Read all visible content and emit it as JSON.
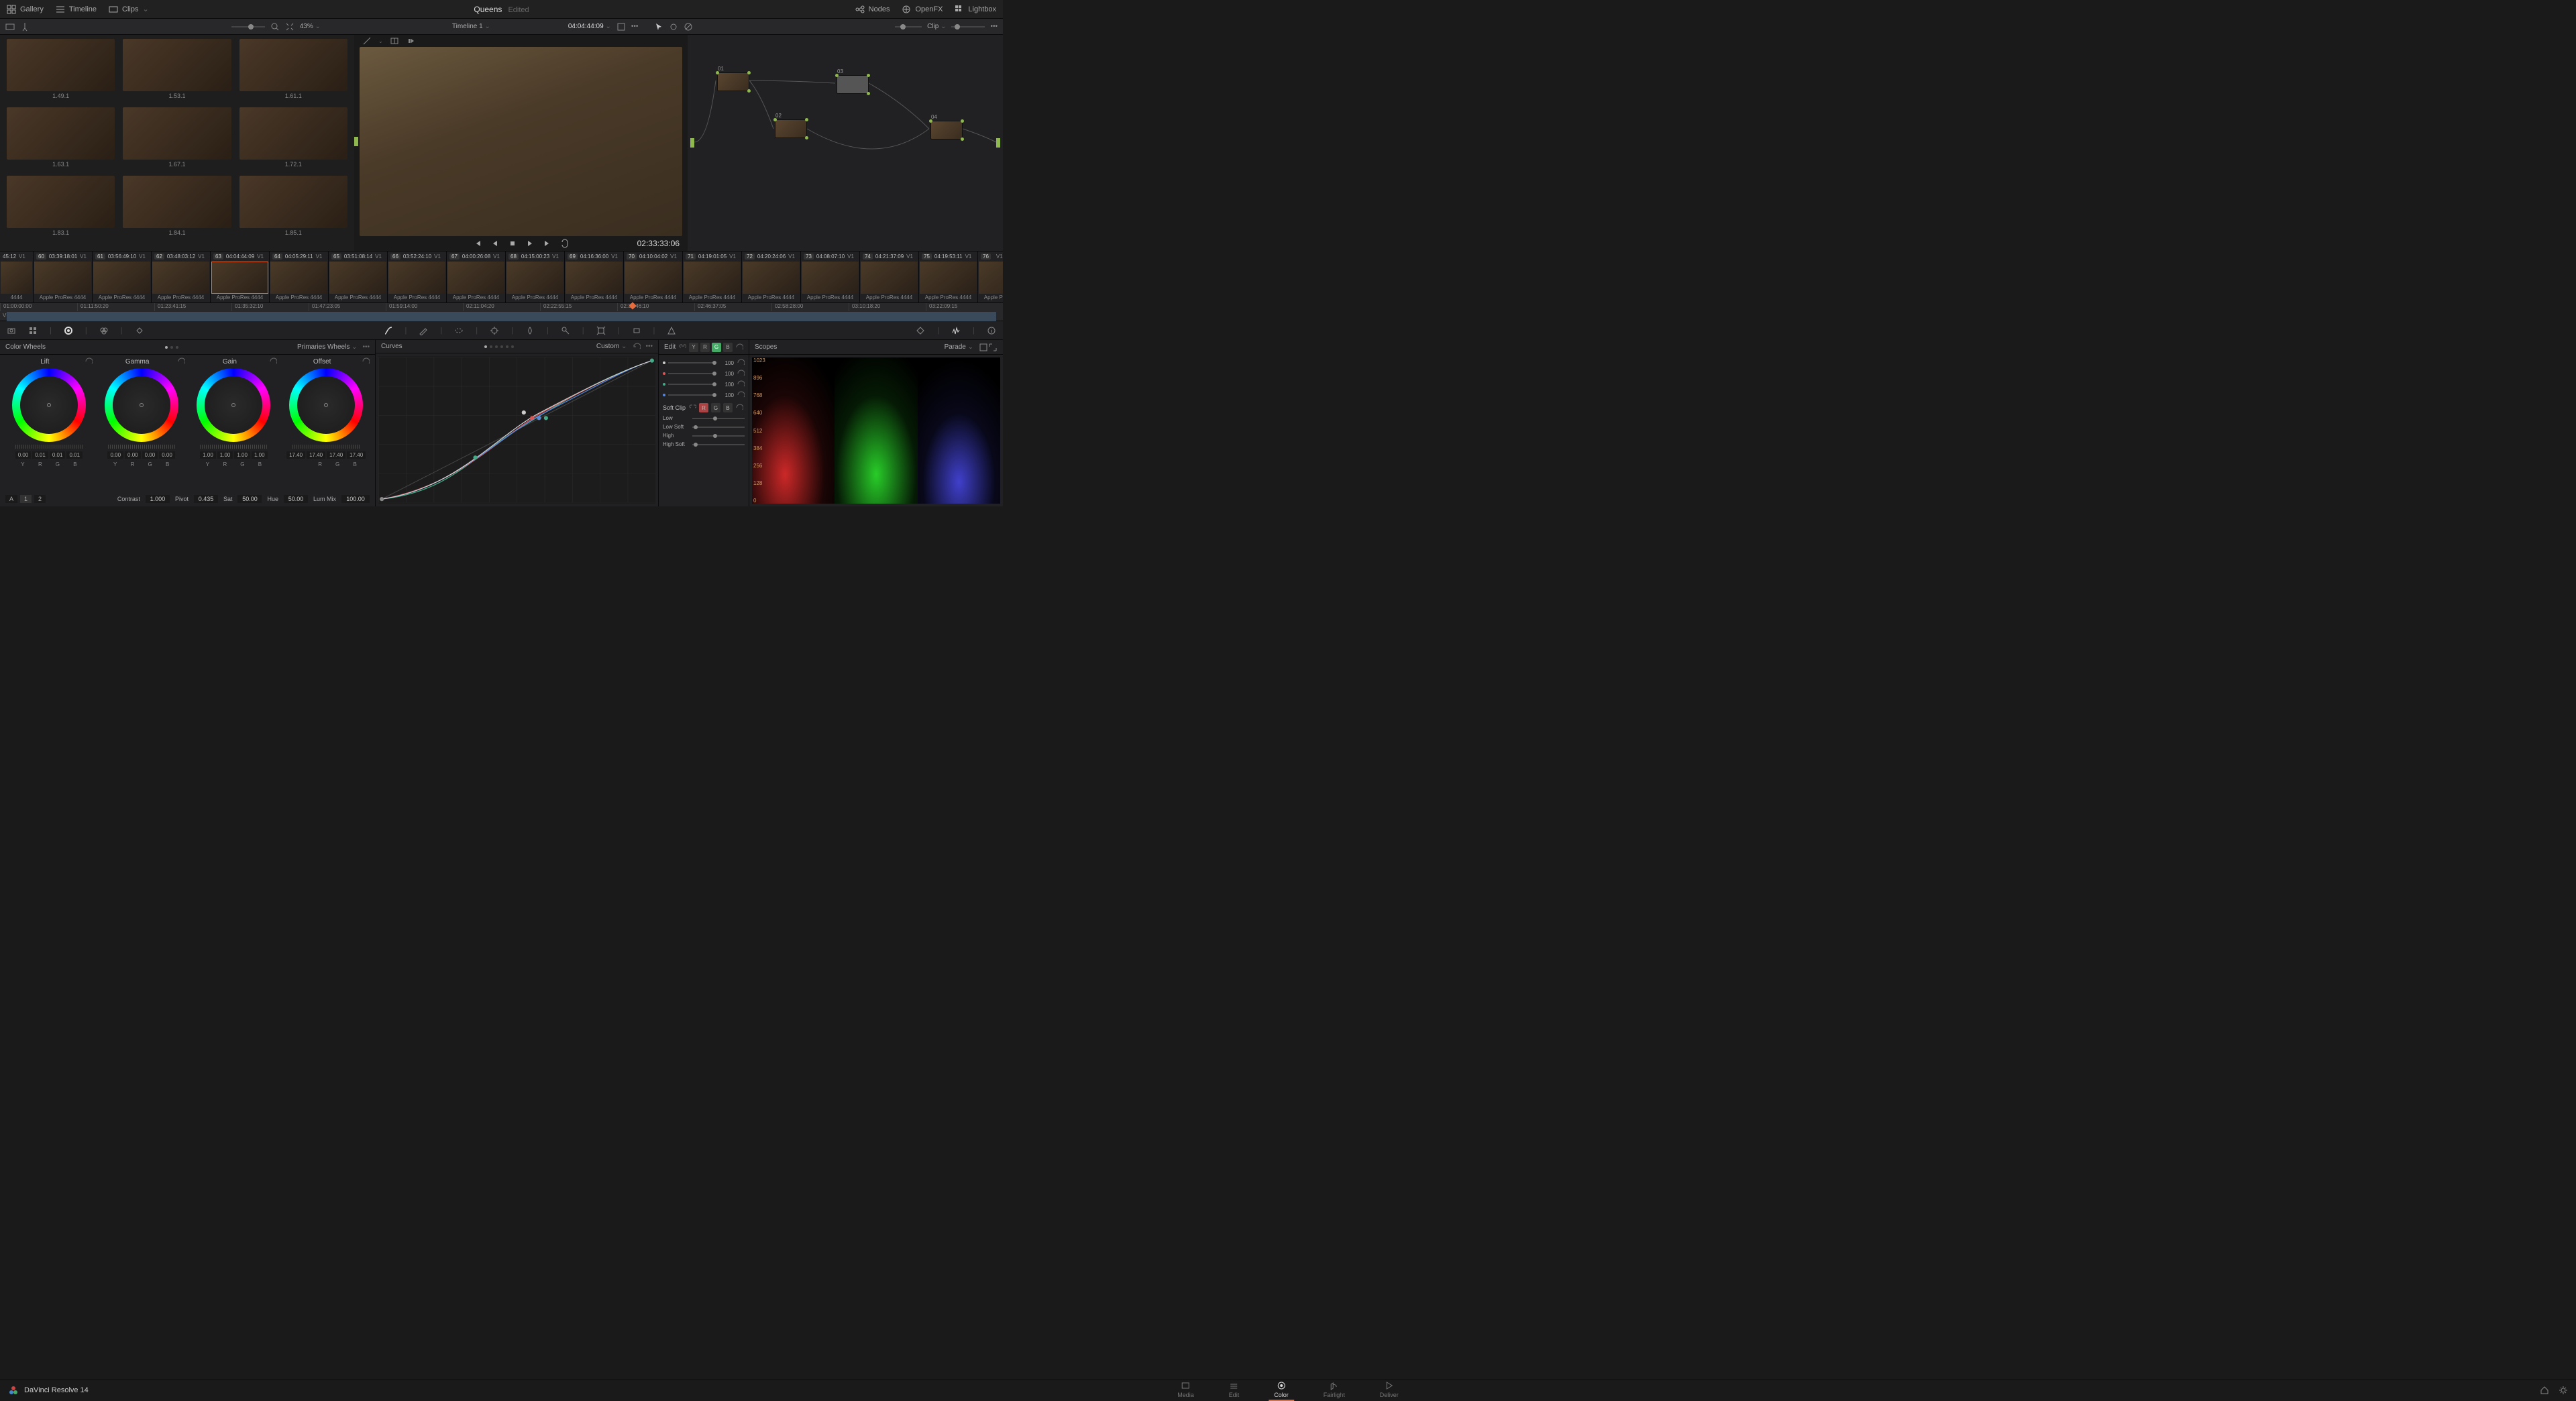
{
  "topbar": {
    "gallery": "Gallery",
    "timeline": "Timeline",
    "clips": "Clips",
    "project": "Queens",
    "status": "Edited",
    "nodes": "Nodes",
    "openfx": "OpenFX",
    "lightbox": "Lightbox"
  },
  "secbar": {
    "zoom": "43%",
    "timeline_name": "Timeline 1",
    "timecode": "04:04:44:09",
    "clip_label": "Clip"
  },
  "gallery": {
    "items": [
      {
        "label": "1.49.1"
      },
      {
        "label": "1.53.1"
      },
      {
        "label": "1.61.1"
      },
      {
        "label": "1.63.1"
      },
      {
        "label": "1.67.1"
      },
      {
        "label": "1.72.1"
      },
      {
        "label": "1.83.1"
      },
      {
        "label": "1.84.1"
      },
      {
        "label": "1.85.1"
      }
    ]
  },
  "viewer": {
    "timecode": "02:33:33:06"
  },
  "nodes": {
    "list": [
      {
        "id": "01"
      },
      {
        "id": "02"
      },
      {
        "id": "03"
      },
      {
        "id": "04"
      }
    ]
  },
  "clips": {
    "first_tc": "45:12",
    "first_track": "V1",
    "list": [
      {
        "n": "60",
        "tc": "03:39:18:01"
      },
      {
        "n": "61",
        "tc": "03:56:49:10"
      },
      {
        "n": "62",
        "tc": "03:48:03:12"
      },
      {
        "n": "63",
        "tc": "04:04:44:09"
      },
      {
        "n": "64",
        "tc": "04:05:29:11"
      },
      {
        "n": "65",
        "tc": "03:51:08:14"
      },
      {
        "n": "66",
        "tc": "03:52:24:10"
      },
      {
        "n": "67",
        "tc": "04:00:26:08"
      },
      {
        "n": "68",
        "tc": "04:15:00:23"
      },
      {
        "n": "69",
        "tc": "04:16:36:00"
      },
      {
        "n": "70",
        "tc": "04:10:04:02"
      },
      {
        "n": "71",
        "tc": "04:19:01:05"
      },
      {
        "n": "72",
        "tc": "04:20:24:06"
      },
      {
        "n": "73",
        "tc": "04:08:07:10"
      },
      {
        "n": "74",
        "tc": "04:21:37:09"
      },
      {
        "n": "75",
        "tc": "04:19:53:11"
      },
      {
        "n": "76",
        "tc": ""
      }
    ],
    "first_codec_label": "4444",
    "codec": "Apple ProRes 4444"
  },
  "ruler": {
    "ticks": [
      "01:00:00:00",
      "01:11:50:20",
      "01:23:41:15",
      "01:35:32:10",
      "01:47:23:05",
      "01:59:14:00",
      "02:11:04:20",
      "02:22:55:15",
      "02:34:46:10",
      "02:46:37:05",
      "02:58:28:00",
      "03:10:18:20",
      "03:22:09:15"
    ],
    "track": "V1"
  },
  "wheels": {
    "title": "Color Wheels",
    "mode": "Primaries Wheels",
    "cols": [
      {
        "name": "Lift",
        "vals": [
          "0.00",
          "0.01",
          "0.01",
          "0.01"
        ]
      },
      {
        "name": "Gamma",
        "vals": [
          "0.00",
          "0.00",
          "0.00",
          "0.00"
        ]
      },
      {
        "name": "Gain",
        "vals": [
          "1.00",
          "1.00",
          "1.00",
          "1.00"
        ]
      },
      {
        "name": "Offset",
        "vals": [
          "17.40",
          "17.40",
          "17.40",
          "17.40"
        ]
      }
    ],
    "labels": [
      "Y",
      "R",
      "G",
      "B"
    ],
    "page_a": "A",
    "page_1": "1",
    "page_2": "2",
    "contrast_l": "Contrast",
    "contrast_v": "1.000",
    "pivot_l": "Pivot",
    "pivot_v": "0.435",
    "sat_l": "Sat",
    "sat_v": "50.00",
    "hue_l": "Hue",
    "hue_v": "50.00",
    "lummix_l": "Lum Mix",
    "lummix_v": "100.00"
  },
  "curves": {
    "title": "Curves",
    "mode": "Custom"
  },
  "edit": {
    "title": "Edit",
    "channels": [
      "Y",
      "R",
      "G",
      "B"
    ],
    "val": "100",
    "softclip": "Soft Clip",
    "low": "Low",
    "lowsoft": "Low Soft",
    "high": "High",
    "highsoft": "High Soft"
  },
  "scopes": {
    "title": "Scopes",
    "mode": "Parade",
    "ticks": [
      "1023",
      "896",
      "768",
      "640",
      "512",
      "384",
      "256",
      "128",
      "0"
    ]
  },
  "pages": {
    "media": "Media",
    "edit": "Edit",
    "color": "Color",
    "fairlight": "Fairlight",
    "deliver": "Deliver"
  },
  "app": "DaVinci Resolve 14"
}
